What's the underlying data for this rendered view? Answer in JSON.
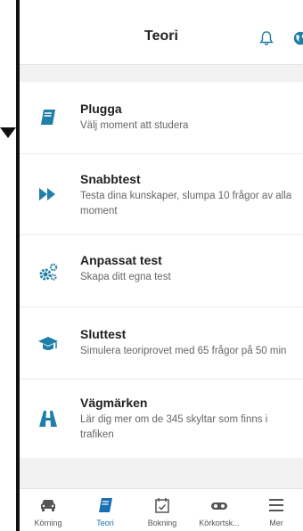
{
  "header": {
    "title": "Teori"
  },
  "items": [
    {
      "title": "Plugga",
      "desc": "Välj moment att studera",
      "icon": "book-icon"
    },
    {
      "title": "Snabbtest",
      "desc": "Testa dina kunskaper, slumpa 10 frågor av alla moment",
      "icon": "fast-forward-icon"
    },
    {
      "title": "Anpassat test",
      "desc": "Skapa ditt egna test",
      "icon": "gears-icon"
    },
    {
      "title": "Sluttest",
      "desc": "Simulera teoriprovet med 65 frågor på 50 min",
      "icon": "graduation-cap-icon"
    },
    {
      "title": "Vägmärken",
      "desc": "Lär dig mer om de 345 skyltar som finns i trafiken",
      "icon": "road-icon"
    }
  ],
  "tabs": [
    {
      "label": "Körning",
      "icon": "car-icon"
    },
    {
      "label": "Teori",
      "icon": "book-icon",
      "active": true
    },
    {
      "label": "Bokning",
      "icon": "calendar-check-icon"
    },
    {
      "label": "Körkortsk...",
      "icon": "glasses-icon"
    },
    {
      "label": "Mer",
      "icon": "menu-icon"
    }
  ],
  "colors": {
    "accent": "#1a6fb5",
    "icon_teal": "#1e7fa8",
    "background": "#f2f2f2"
  }
}
